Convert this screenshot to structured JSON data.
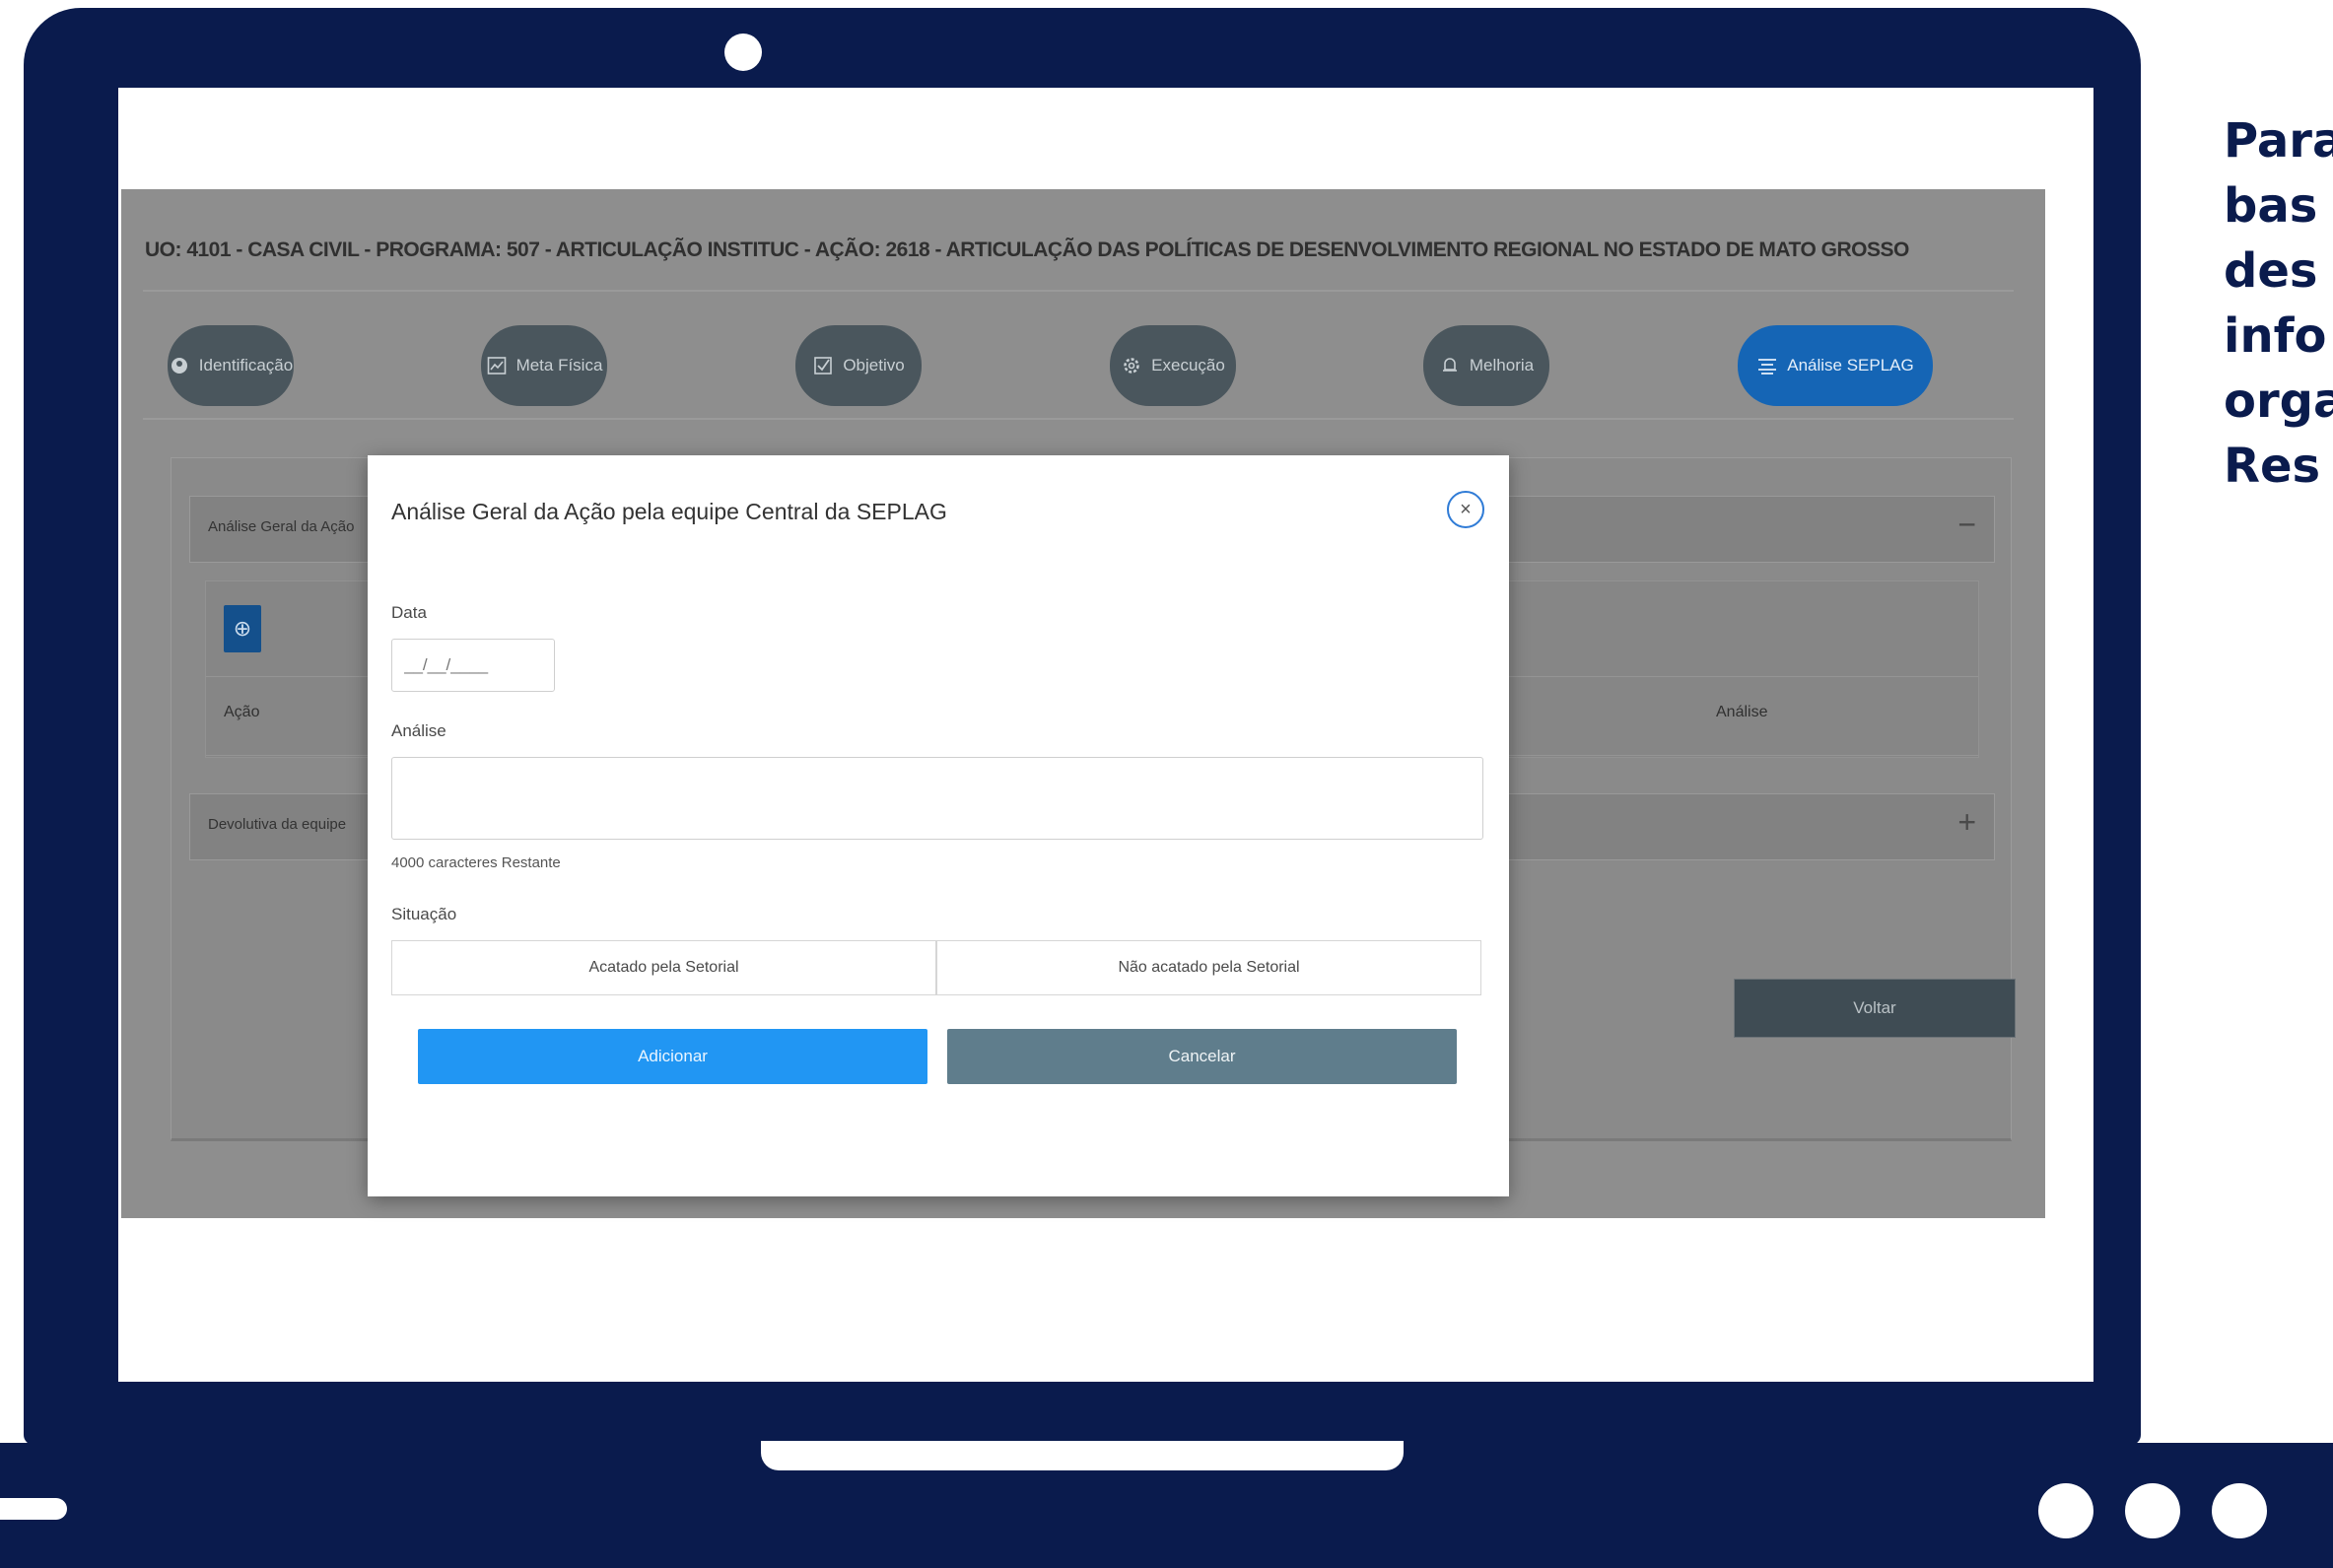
{
  "side_text": [
    "Para",
    "bas",
    "des",
    "info",
    "orga",
    "Res"
  ],
  "app": {
    "header": "UO: 4101 - CASA CIVIL - PROGRAMA: 507 - ARTICULAÇÃO INSTITUC - AÇÃO: 2618 - ARTICULAÇÃO DAS POLÍTICAS DE DESENVOLVIMENTO REGIONAL NO ESTADO DE MATO GROSSO",
    "tabs": [
      {
        "label": "Identificação",
        "icon": "id-badge-icon"
      },
      {
        "label": "Meta Física",
        "icon": "chart-line-icon"
      },
      {
        "label": "Objetivo",
        "icon": "checkbox-icon"
      },
      {
        "label": "Execução",
        "icon": "gear-icon"
      },
      {
        "label": "Melhoria",
        "icon": "bell-icon"
      },
      {
        "label": "Análise SEPLAG",
        "icon": "list-icon",
        "active": true
      }
    ],
    "accordion1": {
      "title": "Análise Geral da Ação",
      "toggle": "−"
    },
    "accordion2": {
      "title": "Devolutiva da equipe",
      "toggle": "+"
    },
    "table": {
      "add_icon": "⊕",
      "col_acao": "Ação",
      "col_analise": "Análise"
    },
    "voltar": "Voltar"
  },
  "modal": {
    "title": "Análise Geral da Ação pela equipe Central da SEPLAG",
    "close_icon": "×",
    "data_label": "Data",
    "data_placeholder": "__/__/____",
    "analise_label": "Análise",
    "chars_remaining": "4000 caracteres Restante",
    "situacao_label": "Situação",
    "situacao_options": [
      "Acatado pela Setorial",
      "Não acatado pela Setorial"
    ],
    "add_button": "Adicionar",
    "cancel_button": "Cancelar"
  },
  "colors": {
    "frame": "#0a1b4d",
    "active_tab": "#1565b5",
    "add_button": "#2196f3",
    "cancel_button": "#5f7d8c"
  }
}
